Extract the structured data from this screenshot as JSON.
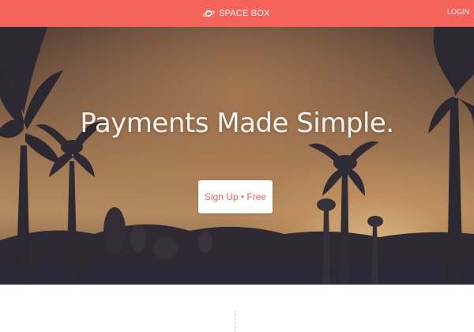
{
  "colors": {
    "accent": "#f5645a",
    "cta_bg": "#ffffff",
    "headline": "#f8f3ee"
  },
  "navbar": {
    "brand": "SPACE BOX",
    "brand_icon": "planet-icon",
    "login": "LOGIN"
  },
  "hero": {
    "headline": "Payments Made Simple.",
    "cta_label": "Sign Up • Free",
    "background": "sunset-palm-trees-photo"
  }
}
